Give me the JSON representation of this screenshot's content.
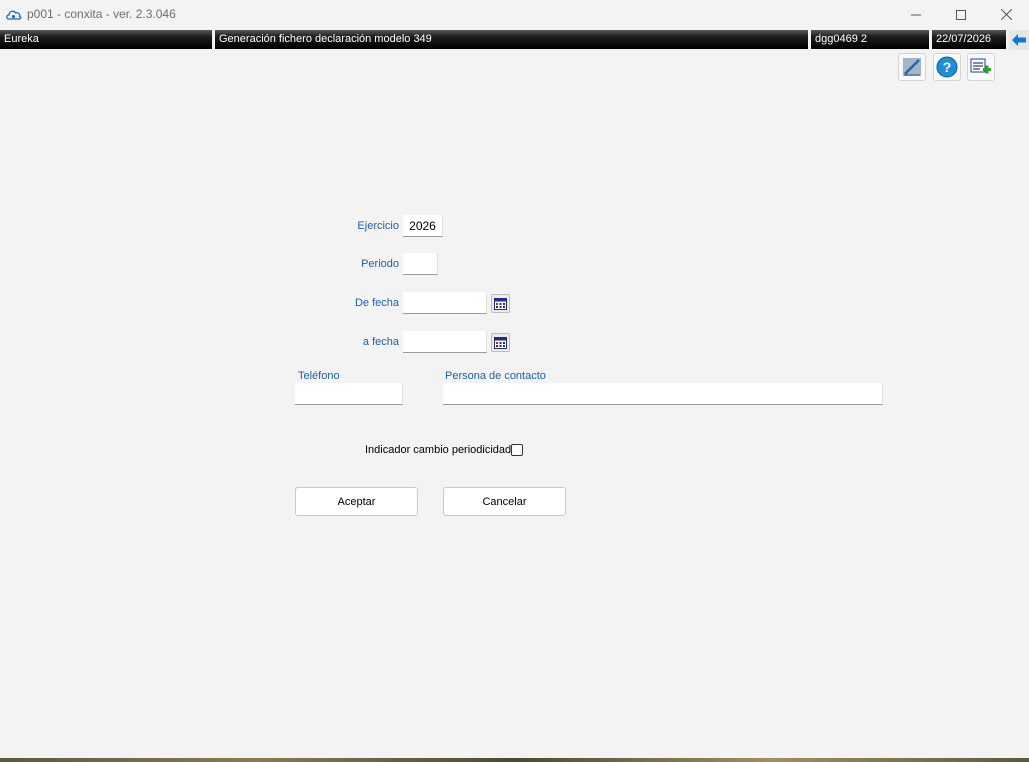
{
  "window": {
    "title": "p001 - conxita - ver. 2.3.046"
  },
  "statusbar": {
    "app": "Eureka",
    "process": "Generación fichero declaración modelo 349",
    "user": "dgg0469  2",
    "date": "22/07/2026"
  },
  "form": {
    "ejercicio_label": "Ejercicio",
    "ejercicio_value": "2026",
    "periodo_label": "Periodo",
    "periodo_value": "",
    "de_fecha_label": "De fecha",
    "de_fecha_value": "",
    "a_fecha_label": "a fecha",
    "a_fecha_value": "",
    "telefono_label": "Teléfono",
    "telefono_value": "",
    "contacto_label": "Persona de contacto",
    "contacto_value": "",
    "indicador_label": "Indicador cambio periodicidad",
    "indicador_checked": false
  },
  "buttons": {
    "accept": "Aceptar",
    "cancel": "Cancelar"
  },
  "colors": {
    "label_blue": "#1f5fa8",
    "statusbar_bg": "#000000",
    "accent_blue": "#0a78d4"
  }
}
